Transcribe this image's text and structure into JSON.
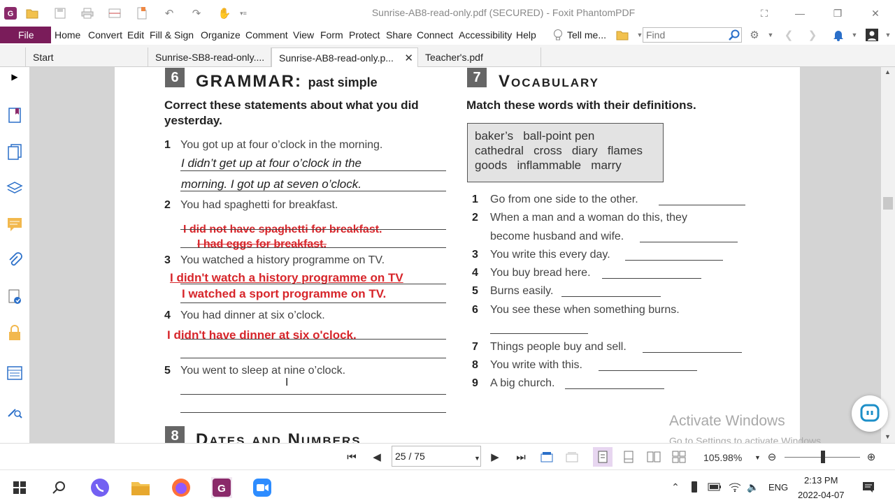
{
  "window": {
    "title": "Sunrise-AB8-read-only.pdf (SECURED) - Foxit PhantomPDF"
  },
  "menu": {
    "file": "File",
    "items": [
      "Home",
      "Convert",
      "Edit",
      "Fill & Sign",
      "Organize",
      "Comment",
      "View",
      "Form",
      "Protect",
      "Share",
      "Connect",
      "Accessibility",
      "Help"
    ],
    "tell_me": "Tell me...",
    "find_placeholder": "Find"
  },
  "tabs": [
    {
      "label": "Start"
    },
    {
      "label": "Sunrise-SB8-read-only...."
    },
    {
      "label": "Sunrise-AB8-read-only.p...",
      "active": true
    },
    {
      "label": "Teacher's.pdf"
    }
  ],
  "document": {
    "grammar": {
      "number": "6",
      "title": "Grammar:",
      "subtitle": "past simple",
      "instruction": "Correct these statements about what you did yesterday.",
      "questions": [
        {
          "num": "1",
          "text": "You got up at four o’clock in the morning."
        },
        {
          "num": "2",
          "text": "You had spaghetti for breakfast."
        },
        {
          "num": "3",
          "text": "You watched a history programme on TV."
        },
        {
          "num": "4",
          "text": "You had dinner at six o’clock."
        },
        {
          "num": "5",
          "text": "You went to sleep at nine o’clock."
        }
      ],
      "example_answer": [
        "I didn’t get up at four o’clock in the",
        "morning. I got up at seven o’clock."
      ],
      "student_answers": {
        "q2": [
          "I did not have spaghetti for breakfast.",
          "I had eggs for breakfast."
        ],
        "q3": [
          "I didn't watch a history programme on TV",
          "I watched a sport programme on TV."
        ],
        "q4": [
          "I didn't have dinner at six o'clock."
        ]
      }
    },
    "vocabulary": {
      "number": "7",
      "title": "Vocabulary",
      "instruction": "Match these words with their definitions.",
      "word_lines": [
        "baker’s   ball-point pen",
        "cathedral   cross   diary   flames",
        "goods   inflammable   marry"
      ],
      "questions": [
        {
          "num": "1",
          "text": "Go from one side to the other."
        },
        {
          "num": "2",
          "text": "When a man and a woman do this, they",
          "text2": "become husband and wife."
        },
        {
          "num": "3",
          "text": "You write this every day."
        },
        {
          "num": "4",
          "text": "You buy bread here."
        },
        {
          "num": "5",
          "text": "Burns easily."
        },
        {
          "num": "6",
          "text": "You see these when something burns."
        },
        {
          "num": "7",
          "text": "Things people buy and sell."
        },
        {
          "num": "8",
          "text": "You write with this."
        },
        {
          "num": "9",
          "text": "A big church."
        }
      ]
    },
    "dates": {
      "number": "8",
      "title": "Dates and Numbers"
    }
  },
  "status": {
    "page": "25 / 75",
    "zoom": "105.98%"
  },
  "watermark": {
    "line1": "Activate Windows",
    "line2": "Go to Settings to activate Windows."
  },
  "taskbar": {
    "lang": "ENG",
    "time": "2:13 PM",
    "date": "2022-04-07"
  }
}
